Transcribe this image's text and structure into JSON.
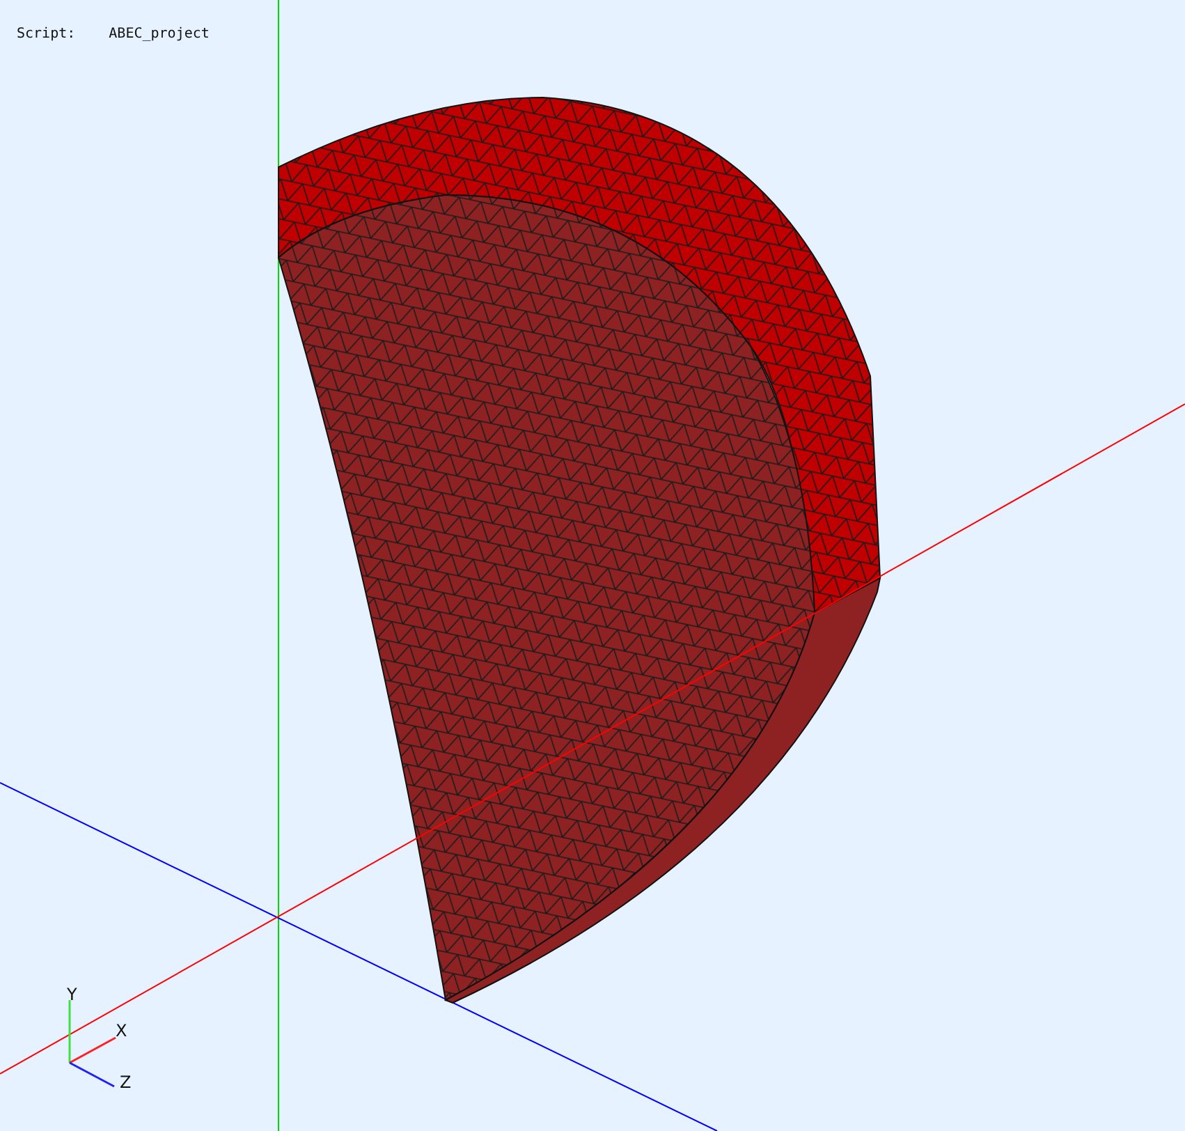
{
  "script_label": "Script:",
  "script_name": "ABEC_project",
  "axis_triad": {
    "y_label": "Y",
    "x_label": "X",
    "z_label": "Z"
  }
}
